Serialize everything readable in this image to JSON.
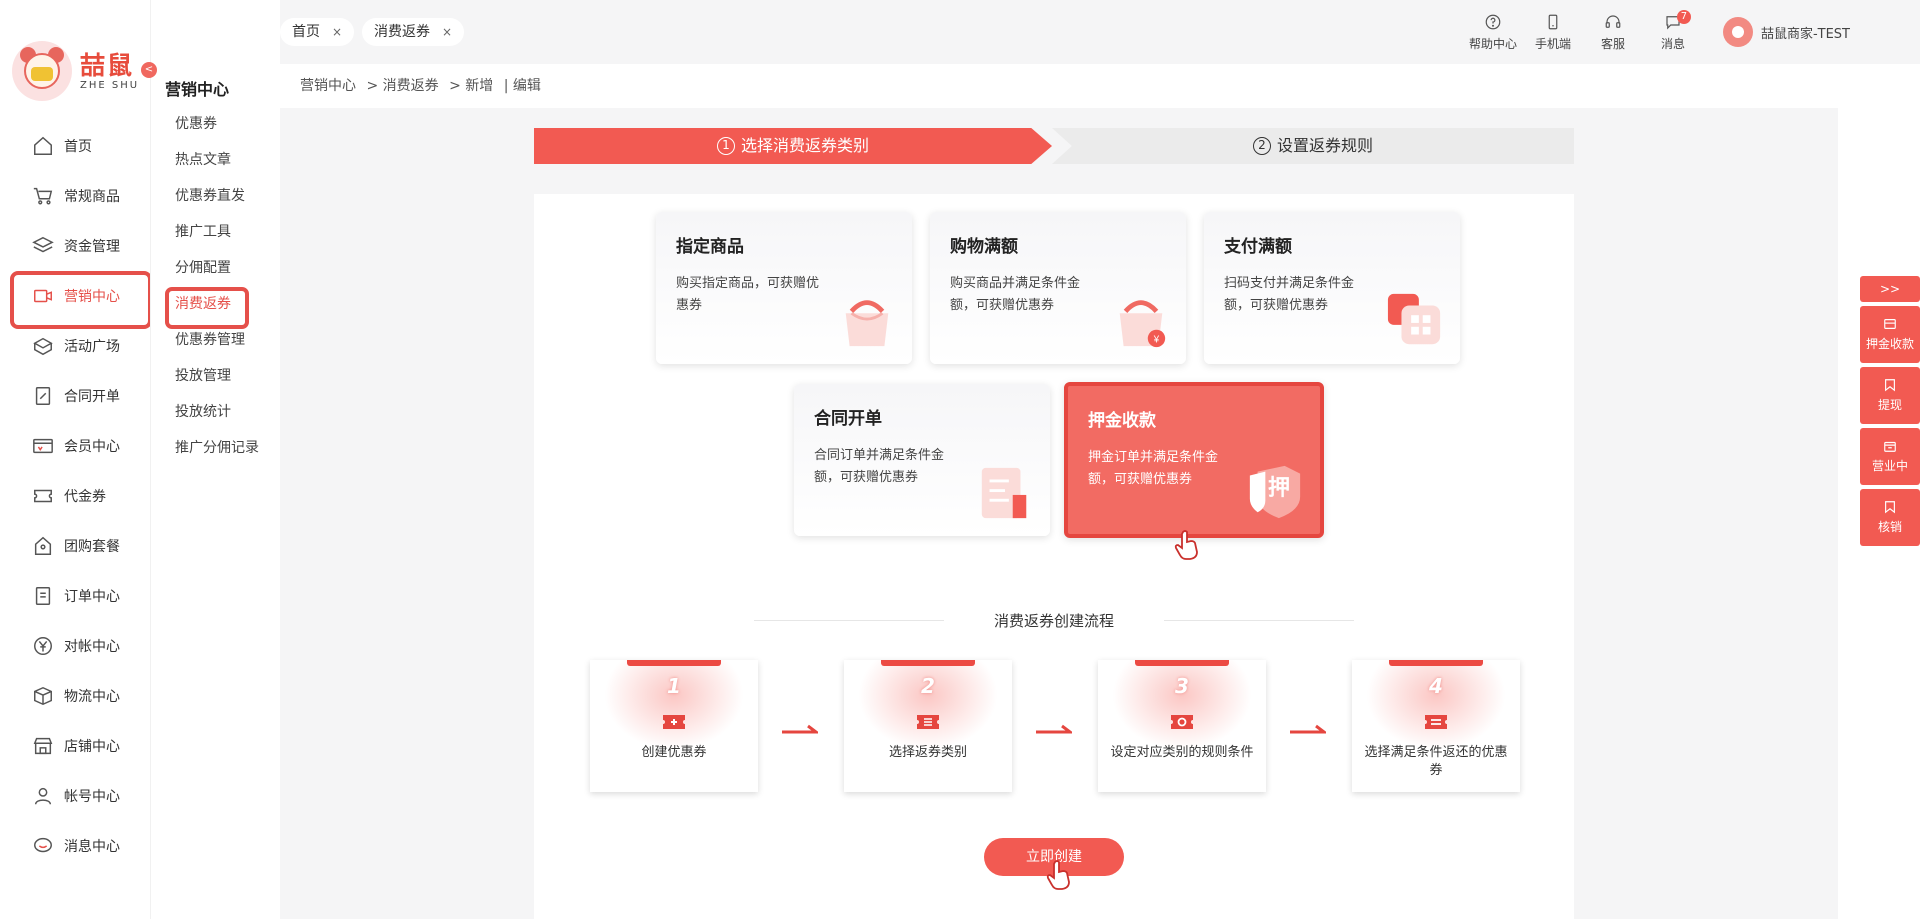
{
  "brand": {
    "cn": "喆鼠",
    "en": "ZHE SHU"
  },
  "nav": {
    "items": [
      {
        "label": "首页",
        "icon": "home-icon"
      },
      {
        "label": "常规商品",
        "icon": "cart-icon"
      },
      {
        "label": "资金管理",
        "icon": "layers-icon"
      },
      {
        "label": "营销中心",
        "icon": "marketing-icon",
        "active": true
      },
      {
        "label": "活动广场",
        "icon": "box-icon"
      },
      {
        "label": "合同开单",
        "icon": "contract-icon"
      },
      {
        "label": "会员中心",
        "icon": "vip-card-icon"
      },
      {
        "label": "代金券",
        "icon": "ticket-icon"
      },
      {
        "label": "团购套餐",
        "icon": "group-buy-icon"
      },
      {
        "label": "订单中心",
        "icon": "order-icon"
      },
      {
        "label": "对帐中心",
        "icon": "yen-icon"
      },
      {
        "label": "物流中心",
        "icon": "package-icon"
      },
      {
        "label": "店铺中心",
        "icon": "shop-icon"
      },
      {
        "label": "帐号中心",
        "icon": "user-icon"
      },
      {
        "label": "消息中心",
        "icon": "chat-icon"
      }
    ]
  },
  "subnav": {
    "title": "营销中心",
    "items": [
      {
        "label": "优惠券"
      },
      {
        "label": "热点文章"
      },
      {
        "label": "优惠券直发"
      },
      {
        "label": "推广工具"
      },
      {
        "label": "分佣配置"
      },
      {
        "label": "消费返券",
        "active": true
      },
      {
        "label": "优惠券管理"
      },
      {
        "label": "投放管理"
      },
      {
        "label": "投放统计"
      },
      {
        "label": "推广分佣记录"
      }
    ]
  },
  "tabs": [
    {
      "label": "首页",
      "close": "×"
    },
    {
      "label": "消费返券",
      "close": "×"
    }
  ],
  "toolbar": {
    "help": "帮助中心",
    "mobile": "手机端",
    "service": "客服",
    "messages": "消息",
    "message_count": "7",
    "user": "喆鼠商家-TEST"
  },
  "breadcrumb": [
    "营销中心",
    "> 消费返券",
    "> 新增",
    "| 编辑"
  ],
  "steps": [
    {
      "num": "1",
      "label": "选择消费返券类别"
    },
    {
      "num": "2",
      "label": "设置返券规则"
    }
  ],
  "categories": [
    {
      "title": "指定商品",
      "desc": "购买指定商品，可获赠优惠券"
    },
    {
      "title": "购物满额",
      "desc": "购买商品并满足条件金额，可获赠优惠券"
    },
    {
      "title": "支付满额",
      "desc": "扫码支付并满足条件金额，可获赠优惠券"
    },
    {
      "title": "合同开单",
      "desc": "合同订单并满足条件金额，可获赠优惠券"
    },
    {
      "title": "押金收款",
      "desc": "押金订单并满足条件金额，可获赠优惠券",
      "icon_text": "押"
    }
  ],
  "process": {
    "title": "消费返券创建流程",
    "steps": [
      {
        "num": "1",
        "label": "创建优惠券"
      },
      {
        "num": "2",
        "label": "选择返券类别"
      },
      {
        "num": "3",
        "label": "设定对应类别的规则条件"
      },
      {
        "num": "4",
        "label": "选择满足条件返还的优惠券"
      }
    ]
  },
  "create_button": "立即创建",
  "right_float": {
    "toggle": ">>",
    "items": [
      {
        "label": "押金收款"
      },
      {
        "label": "提现"
      },
      {
        "label": "营业中"
      },
      {
        "label": "核销"
      }
    ]
  },
  "colors": {
    "accent": "#f25a52",
    "accent_dark": "#e5504a"
  }
}
